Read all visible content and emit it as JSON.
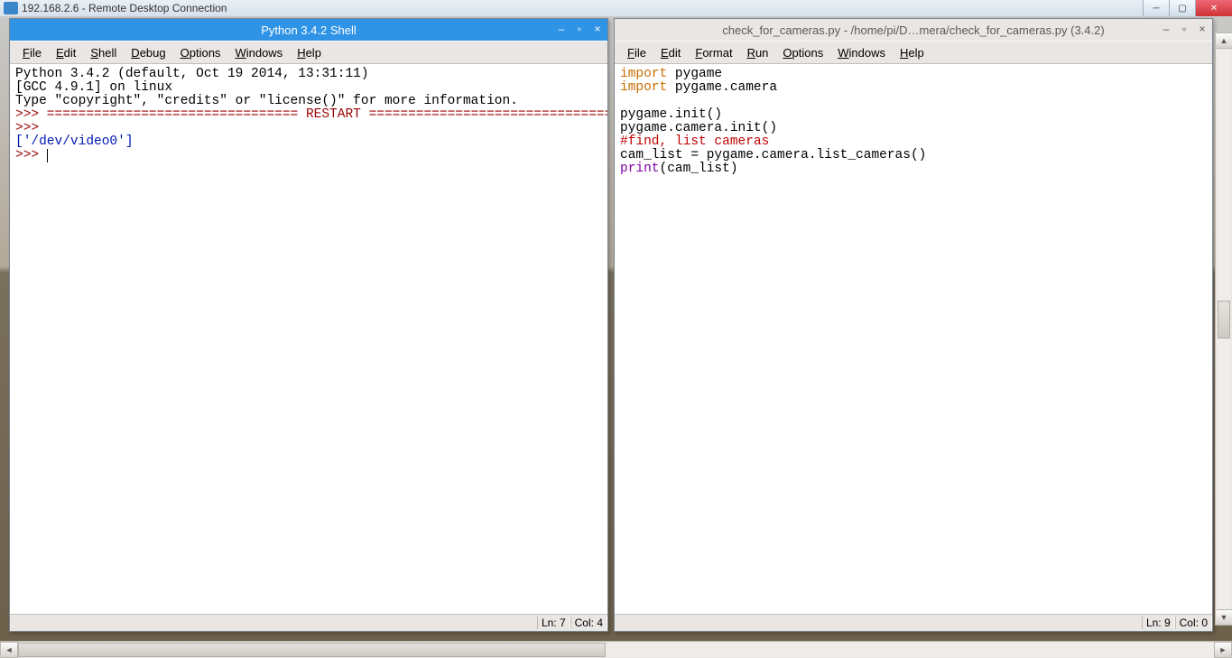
{
  "rdc": {
    "title": "192.168.2.6 - Remote Desktop Connection"
  },
  "left": {
    "title": "Python 3.4.2 Shell",
    "menus": [
      "File",
      "Edit",
      "Shell",
      "Debug",
      "Options",
      "Windows",
      "Help"
    ],
    "banner": [
      "Python 3.4.2 (default, Oct 19 2014, 13:31:11)",
      "[GCC 4.9.1] on linux",
      "Type \"copyright\", \"credits\" or \"license()\" for more information."
    ],
    "restart": ">>> ================================ RESTART ================================",
    "prompt": ">>> ",
    "output": "['/dev/video0']",
    "status": {
      "ln": "Ln: 7",
      "col": "Col: 4"
    }
  },
  "right": {
    "title": "check_for_cameras.py - /home/pi/D…mera/check_for_cameras.py (3.4.2)",
    "menus": [
      "File",
      "Edit",
      "Format",
      "Run",
      "Options",
      "Windows",
      "Help"
    ],
    "code": {
      "l1_kw": "import",
      "l1_mod": " pygame",
      "l2_kw": "import",
      "l2_mod": " pygame.camera",
      "l3": "",
      "l4": "pygame.init()",
      "l5": "pygame.camera.init()",
      "l6": "#find, list cameras",
      "l7": "cam_list = pygame.camera.list_cameras()",
      "l8_fn": "print",
      "l8_rest": "(cam_list)"
    },
    "status": {
      "ln": "Ln: 9",
      "col": "Col: 0"
    }
  }
}
